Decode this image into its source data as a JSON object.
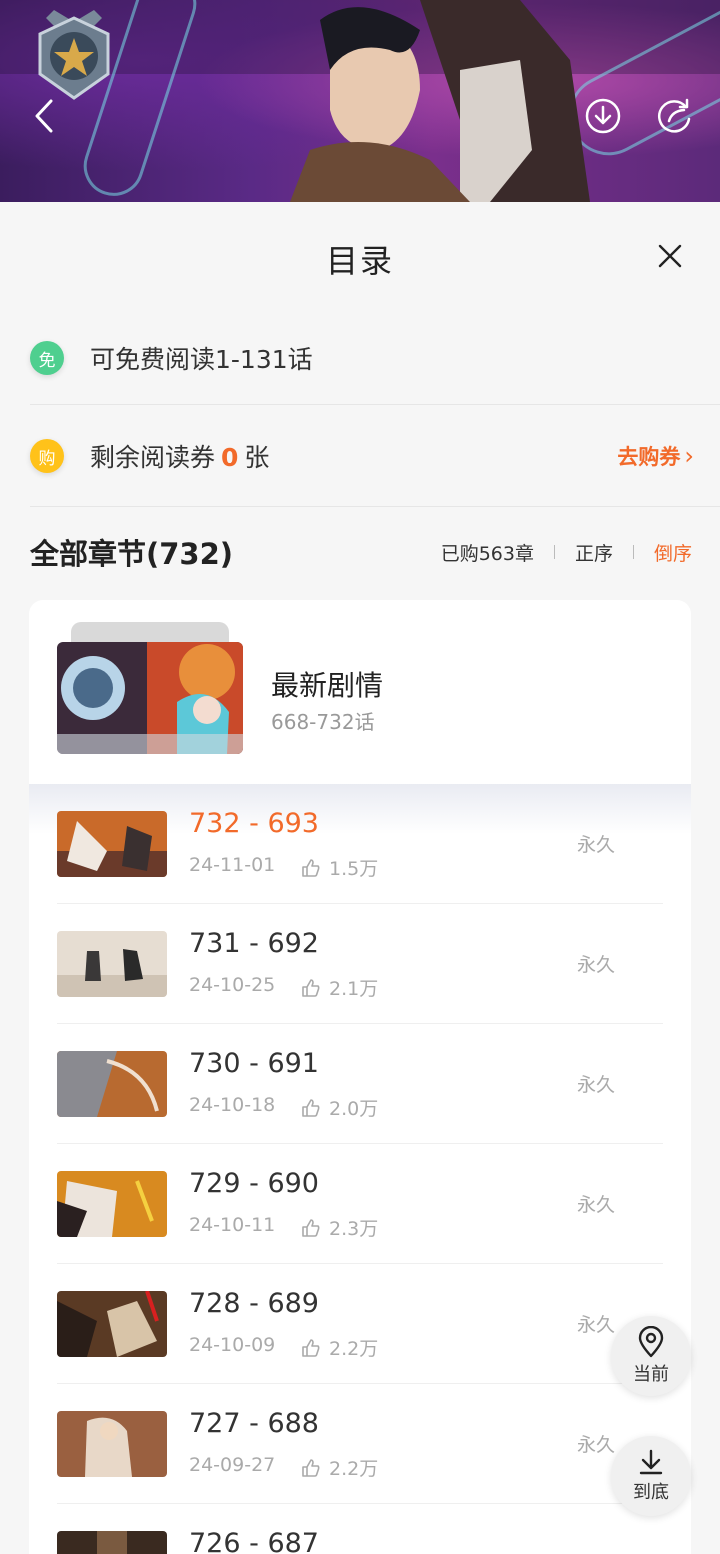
{
  "header": {
    "back_icon": "chevron-left-icon",
    "download_icon": "download-circle-icon",
    "share_icon": "share-icon"
  },
  "sheet": {
    "title": "目录",
    "free_read": {
      "badge": "免",
      "text": "可免费阅读1-131话"
    },
    "vouchers": {
      "badge": "购",
      "prefix": "剩余阅读券",
      "count": "0",
      "suffix": "张",
      "buy_label": "去购券",
      "buy_arrow": "›"
    },
    "section": {
      "title": "全部章节(732)",
      "purchased": "已购563章",
      "order_asc": "正序",
      "order_desc": "倒序"
    },
    "featured": {
      "title": "最新剧情",
      "range": "668-732话"
    },
    "chapters": [
      {
        "title": "732 - 693",
        "date": "24-11-01",
        "likes": "1.5万",
        "status": "永久"
      },
      {
        "title": "731 - 692",
        "date": "24-10-25",
        "likes": "2.1万",
        "status": "永久"
      },
      {
        "title": "730 - 691",
        "date": "24-10-18",
        "likes": "2.0万",
        "status": "永久"
      },
      {
        "title": "729 - 690",
        "date": "24-10-11",
        "likes": "2.3万",
        "status": "永久"
      },
      {
        "title": "728 - 689",
        "date": "24-10-09",
        "likes": "2.2万",
        "status": "永久"
      },
      {
        "title": "727 - 688",
        "date": "24-09-27",
        "likes": "2.2万",
        "status": "永久"
      },
      {
        "title": "726 - 687",
        "date": "",
        "likes": "",
        "status": ""
      }
    ]
  },
  "fab": {
    "current_label": "当前",
    "bottom_label": "到底"
  },
  "colors": {
    "accent": "#f26a2a",
    "free_green": "#4fcf8f",
    "buy_yellow": "#ffc21a"
  }
}
